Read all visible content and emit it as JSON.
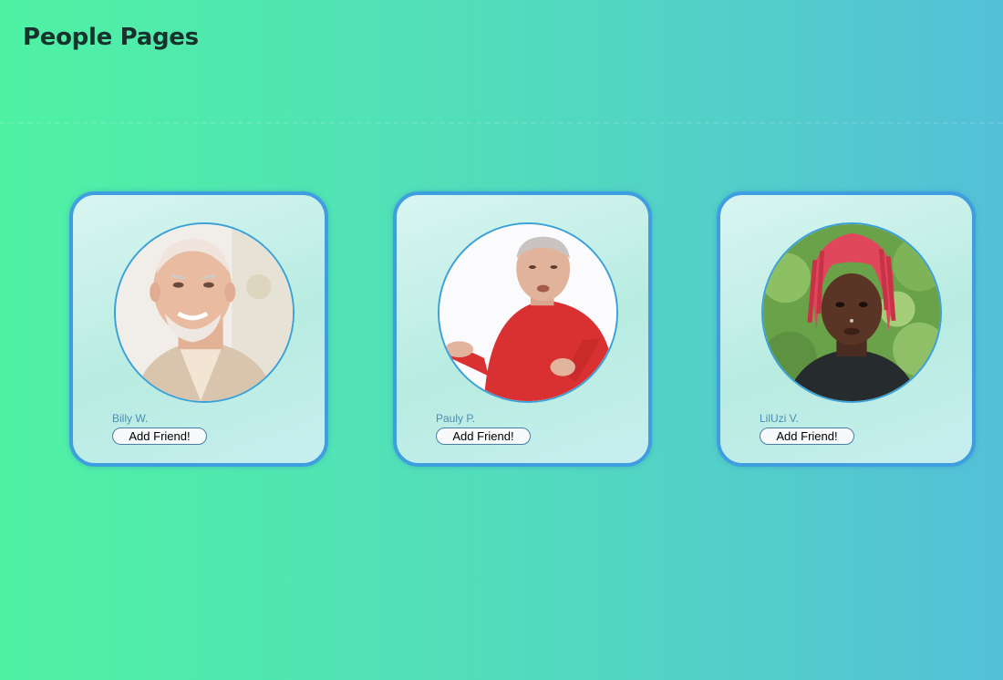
{
  "page": {
    "title": "People Pages"
  },
  "people": [
    {
      "name": "Billy W.",
      "button_label": "Add Friend!",
      "photo": "older-man-smiling-photo"
    },
    {
      "name": "Pauly P.",
      "button_label": "Add Friend!",
      "photo": "older-man-red-sweater-photo"
    },
    {
      "name": "LilUzi V.",
      "button_label": "Add Friend!",
      "photo": "man-red-dreadlocks-photo"
    }
  ],
  "colors": {
    "background_start": "#4ff2a3",
    "background_end": "#54c0d8",
    "card_border": "#3f9ee0",
    "name_text": "#4a8fb0"
  }
}
